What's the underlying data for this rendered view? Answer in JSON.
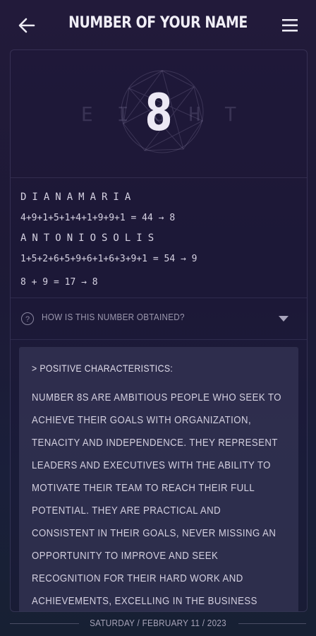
{
  "header": {
    "title": "NUMBER OF YOUR NAME",
    "back_icon": "arrow-left-icon",
    "menu_icon": "hamburger-menu-icon"
  },
  "hero": {
    "number": "8",
    "word": "EIGHT"
  },
  "calculation": {
    "name1_letters": "DIANAMARIA",
    "name1_sum": "4+9+1+5+1+4+1+9+9+1 = 44 → 8",
    "name2_letters": "ANTONIOSOLIS",
    "name2_sum": "1+5+2+6+5+9+6+1+6+3+9+1 = 54 → 9",
    "total": "8 + 9 = 17 → 8"
  },
  "explain": {
    "label": "HOW IS THIS NUMBER OBTAINED?",
    "icon": "question-circle-icon",
    "caret_icon": "caret-down-icon"
  },
  "characteristics": {
    "heading": "> POSITIVE CHARACTERISTICS:",
    "body": "NUMBER 8S ARE AMBITIOUS PEOPLE WHO SEEK TO ACHIEVE THEIR GOALS WITH ORGANIZATION, TENACITY AND INDEPENDENCE. THEY REPRESENT LEADERS AND EXECUTIVES WITH THE ABILITY TO MOTIVATE THEIR TEAM TO REACH THEIR FULL POTENTIAL. THEY ARE PRACTICAL AND CONSISTENT IN THEIR GOALS, NEVER MISSING AN OPPORTUNITY TO IMPROVE AND SEEK RECOGNITION FOR THEIR HARD WORK AND ACHIEVEMENTS, EXCELLING IN THE BUSINESS WORLD OR IN POLITICS."
  },
  "footer": {
    "date": "SATURDAY / FEBRUARY 11 / 2023"
  },
  "colors": {
    "background": "#1f1a38",
    "text": "#d8d4e6",
    "panel": "#3e3e5e"
  }
}
